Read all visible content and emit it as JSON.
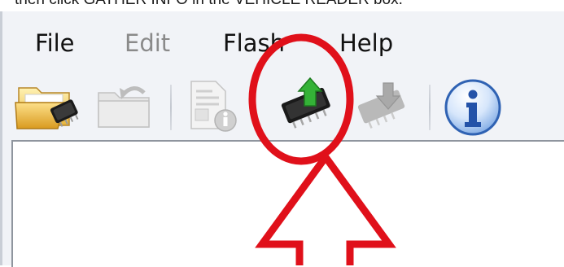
{
  "caption": {
    "text": "then click GATHER INFO in the VEHICLE READER box."
  },
  "menubar": {
    "file": "File",
    "edit": "Edit",
    "flash": "Flash",
    "help": "Help"
  },
  "toolbar": {
    "buttons": [
      {
        "icon": "open-folder-chip-icon",
        "enabled": true
      },
      {
        "icon": "folder-back-icon",
        "enabled": false
      },
      {
        "icon": "document-info-icon",
        "enabled": false
      },
      {
        "icon": "chip-upload-icon",
        "enabled": true
      },
      {
        "icon": "chip-download-icon",
        "enabled": false
      },
      {
        "icon": "info-icon",
        "enabled": true
      }
    ]
  },
  "annotation": {
    "color": "#e0101a",
    "shapes": [
      "circle",
      "arrow-up"
    ]
  }
}
